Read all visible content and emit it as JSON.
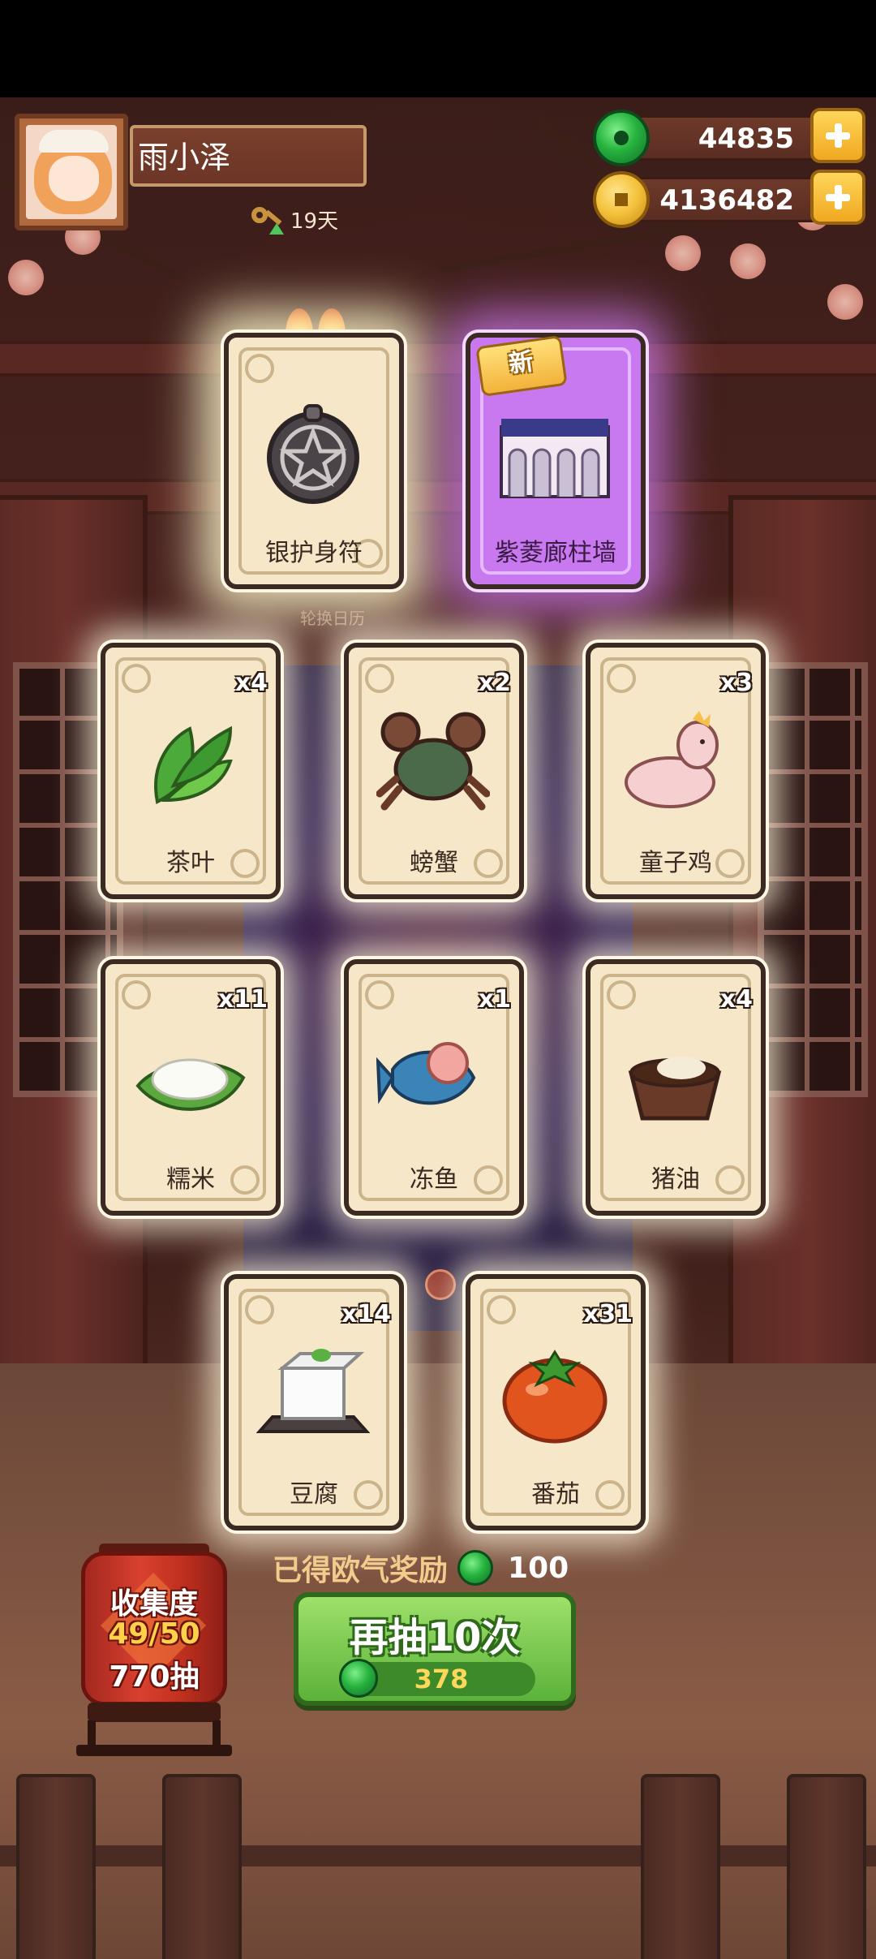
{
  "player": {
    "name": "雨小泽",
    "days": "19天"
  },
  "currency": {
    "jade": "44835",
    "coins": "4136482"
  },
  "top_cards": [
    {
      "name": "银护身符",
      "rarity": "gold",
      "badge": ""
    },
    {
      "name": "紫菱廊柱墙",
      "rarity": "purple",
      "badge": "新"
    }
  ],
  "rotate_label": "轮换日历",
  "cards": [
    {
      "name": "茶叶",
      "qty": "x4"
    },
    {
      "name": "螃蟹",
      "qty": "x2"
    },
    {
      "name": "童子鸡",
      "qty": "x3"
    },
    {
      "name": "糯米",
      "qty": "x11"
    },
    {
      "name": "冻鱼",
      "qty": "x1"
    },
    {
      "name": "猪油",
      "qty": "x4"
    },
    {
      "name": "豆腐",
      "qty": "x14"
    },
    {
      "name": "番茄",
      "qty": "x31"
    }
  ],
  "reward": {
    "label": "已得欧气奖励",
    "value": "100"
  },
  "draw_button": {
    "label": "再抽10次",
    "cost": "378"
  },
  "collection": {
    "title": "收集度",
    "progress": "49/50",
    "draws": "770抽"
  },
  "colors": {
    "jade": "#27b33e",
    "coin": "#f4c13a",
    "button_green": "#5bb23a",
    "lantern_red": "#d9402f",
    "purple_card": "#c979f0"
  }
}
